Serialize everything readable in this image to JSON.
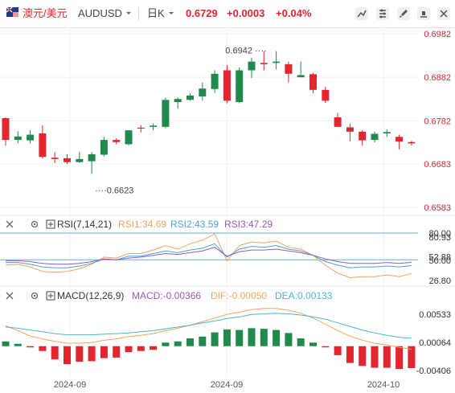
{
  "toolbar": {
    "pair_cn": "澳元/美元",
    "symbol": "AUDUSD",
    "period": "日K",
    "price": "0.6729",
    "change": "+0.0003",
    "change_pct": "+0.04%"
  },
  "panels": {
    "rsi": {
      "label": "RSI(7,14,21)",
      "rsi1": "RSI1:34.69",
      "rsi2": "RSI2:43.59",
      "rsi3": "RSI3:47.29"
    },
    "macd": {
      "label": "MACD(12,26,9)",
      "macd": "MACD:-0.00366",
      "dif": "DIF:-0.00050",
      "dea": "DEA:0.00133"
    }
  },
  "colors": {
    "up": "#e3252f",
    "down": "#1f8a4c",
    "rsi1": "#f4a460",
    "rsi2": "#4aa3df",
    "rsi3": "#9b59b6",
    "dif": "#f4a460",
    "dea": "#4cb7c9",
    "level": "#5aaee6"
  },
  "chart_data": [
    {
      "type": "candlestick",
      "title": "",
      "ylim": [
        0.6583,
        0.6982
      ],
      "y_ticks": [
        "0.6982",
        "0.6882",
        "0.6782",
        "0.6683",
        "0.6583"
      ],
      "x_ticks": [
        "2024-09",
        "2024-09",
        "2024-10"
      ],
      "annotations": [
        {
          "text": "0.6942",
          "kind": "high"
        },
        {
          "text": "0.6623",
          "kind": "low"
        }
      ],
      "candles": [
        {
          "o": 0.6788,
          "h": 0.679,
          "l": 0.6725,
          "c": 0.6738
        },
        {
          "o": 0.6738,
          "h": 0.6758,
          "l": 0.673,
          "c": 0.6746
        },
        {
          "o": 0.6737,
          "h": 0.676,
          "l": 0.673,
          "c": 0.675
        },
        {
          "o": 0.6753,
          "h": 0.6772,
          "l": 0.6695,
          "c": 0.6699
        },
        {
          "o": 0.6697,
          "h": 0.671,
          "l": 0.6685,
          "c": 0.6694
        },
        {
          "o": 0.6696,
          "h": 0.6705,
          "l": 0.6683,
          "c": 0.6687
        },
        {
          "o": 0.6687,
          "h": 0.671,
          "l": 0.6685,
          "c": 0.6694
        },
        {
          "o": 0.6689,
          "h": 0.671,
          "l": 0.666,
          "c": 0.6705
        },
        {
          "o": 0.6704,
          "h": 0.6745,
          "l": 0.67,
          "c": 0.6738
        },
        {
          "o": 0.6738,
          "h": 0.6742,
          "l": 0.6728,
          "c": 0.6733
        },
        {
          "o": 0.6728,
          "h": 0.676,
          "l": 0.6726,
          "c": 0.676
        },
        {
          "o": 0.6766,
          "h": 0.6772,
          "l": 0.6755,
          "c": 0.6764
        },
        {
          "o": 0.6768,
          "h": 0.6776,
          "l": 0.676,
          "c": 0.6771
        },
        {
          "o": 0.6768,
          "h": 0.6835,
          "l": 0.6765,
          "c": 0.683
        },
        {
          "o": 0.6825,
          "h": 0.6836,
          "l": 0.681,
          "c": 0.6832
        },
        {
          "o": 0.683,
          "h": 0.6845,
          "l": 0.6828,
          "c": 0.684
        },
        {
          "o": 0.6838,
          "h": 0.687,
          "l": 0.6828,
          "c": 0.6856
        },
        {
          "o": 0.6855,
          "h": 0.6898,
          "l": 0.6846,
          "c": 0.689
        },
        {
          "o": 0.6898,
          "h": 0.691,
          "l": 0.6822,
          "c": 0.6828
        },
        {
          "o": 0.6825,
          "h": 0.6905,
          "l": 0.6822,
          "c": 0.6898
        },
        {
          "o": 0.6898,
          "h": 0.6927,
          "l": 0.688,
          "c": 0.6918
        },
        {
          "o": 0.6915,
          "h": 0.6942,
          "l": 0.6898,
          "c": 0.6912
        },
        {
          "o": 0.6915,
          "h": 0.6942,
          "l": 0.69,
          "c": 0.6918
        },
        {
          "o": 0.6912,
          "h": 0.6918,
          "l": 0.687,
          "c": 0.689
        },
        {
          "o": 0.6882,
          "h": 0.6918,
          "l": 0.6882,
          "c": 0.6887
        },
        {
          "o": 0.6889,
          "h": 0.6892,
          "l": 0.6845,
          "c": 0.6853
        },
        {
          "o": 0.6853,
          "h": 0.686,
          "l": 0.6823,
          "c": 0.6828
        },
        {
          "o": 0.679,
          "h": 0.68,
          "l": 0.677,
          "c": 0.6768
        },
        {
          "o": 0.6767,
          "h": 0.6775,
          "l": 0.6735,
          "c": 0.6757
        },
        {
          "o": 0.6757,
          "h": 0.676,
          "l": 0.6725,
          "c": 0.6737
        },
        {
          "o": 0.6738,
          "h": 0.6757,
          "l": 0.6732,
          "c": 0.6752
        },
        {
          "o": 0.6753,
          "h": 0.6762,
          "l": 0.6745,
          "c": 0.6756
        },
        {
          "o": 0.6745,
          "h": 0.675,
          "l": 0.6716,
          "c": 0.6734
        },
        {
          "o": 0.6733,
          "h": 0.6736,
          "l": 0.6725,
          "c": 0.673
        }
      ]
    },
    {
      "type": "line",
      "title": "RSI(7,14,21)",
      "y_ticks": [
        "80.00",
        "80.93",
        "52.88",
        "50.00",
        "26.80"
      ],
      "series": [
        {
          "name": "RSI1",
          "values": [
            44,
            45,
            42,
            37,
            36,
            37,
            40,
            45,
            53,
            52,
            57,
            57,
            61,
            66,
            62,
            68,
            72,
            79,
            49,
            66,
            70,
            69,
            71,
            64,
            62,
            55,
            44,
            35,
            30,
            31,
            31,
            33,
            31,
            34.69
          ]
        },
        {
          "name": "RSI2",
          "values": [
            47,
            47,
            45,
            42,
            41,
            41,
            43,
            46,
            51,
            50,
            54,
            54,
            57,
            60,
            58,
            61,
            63,
            68,
            53,
            62,
            65,
            64,
            66,
            62,
            60,
            55,
            48,
            44,
            41,
            42,
            42,
            43,
            42,
            43.59
          ]
        },
        {
          "name": "RSI3",
          "values": [
            49,
            49,
            48,
            46,
            45,
            45,
            46,
            48,
            51,
            50,
            52,
            53,
            55,
            57,
            56,
            58,
            60,
            64,
            54,
            59,
            61,
            61,
            62,
            60,
            58,
            55,
            51,
            48,
            46,
            46,
            46,
            47,
            46,
            47.29
          ]
        }
      ]
    },
    {
      "type": "bar+line",
      "title": "MACD(12,26,9)",
      "y_ticks": [
        "0.00533",
        "0.00064",
        "-0.00406"
      ],
      "series": [
        {
          "name": "MACD",
          "values": [
            0.0008,
            0.0004,
            -0.0002,
            -0.0008,
            -0.0022,
            -0.003,
            -0.0026,
            -0.0025,
            -0.002,
            -0.0019,
            -0.001,
            -0.0008,
            -0.0006,
            0.0006,
            0.0008,
            0.0013,
            0.0016,
            0.0023,
            0.0028,
            0.0027,
            0.003,
            0.0029,
            0.0027,
            0.0022,
            0.0013,
            0.0006,
            -0.0002,
            -0.0015,
            -0.0028,
            -0.0033,
            -0.0036,
            -0.0036,
            -0.0038,
            -0.00366
          ]
        },
        {
          "name": "DIF",
          "values": [
            0.0034,
            0.0026,
            0.0017,
            0.0012,
            0.0008,
            0.0005,
            0.0005,
            0.0006,
            0.001,
            0.0012,
            0.0016,
            0.0018,
            0.0021,
            0.0026,
            0.003,
            0.0035,
            0.0041,
            0.0047,
            0.0053,
            0.0057,
            0.0061,
            0.0063,
            0.0063,
            0.006,
            0.0055,
            0.0047,
            0.0037,
            0.0026,
            0.0017,
            0.001,
            0.0005,
            0.0002,
            -0.0002,
            -0.0005
          ]
        },
        {
          "name": "DEA",
          "values": [
            0.0032,
            0.003,
            0.0027,
            0.0024,
            0.0021,
            0.0019,
            0.0019,
            0.0019,
            0.002,
            0.0021,
            0.0022,
            0.0024,
            0.0026,
            0.0029,
            0.0032,
            0.0035,
            0.0039,
            0.0042,
            0.0046,
            0.0049,
            0.0053,
            0.0054,
            0.0055,
            0.0054,
            0.0052,
            0.0049,
            0.0045,
            0.0039,
            0.0033,
            0.0027,
            0.0022,
            0.0018,
            0.0015,
            0.00133
          ]
        }
      ]
    }
  ]
}
